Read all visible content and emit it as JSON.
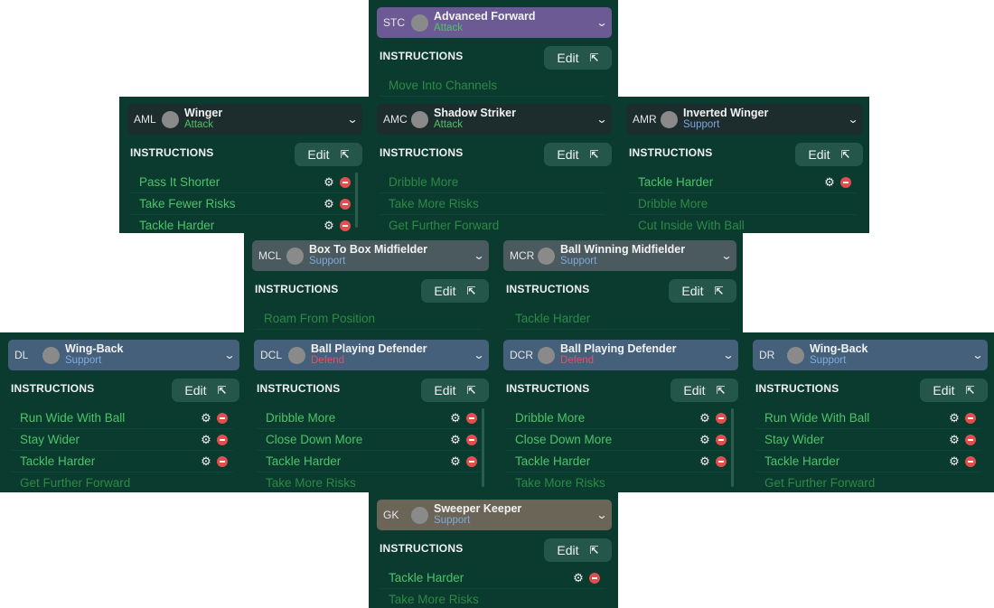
{
  "common": {
    "instructions_label": "INSTRUCTIONS",
    "edit_label": "Edit"
  },
  "panels": {
    "stc": {
      "position": "STC",
      "role": "Advanced Forward",
      "duty": "Attack",
      "instructions": [
        {
          "label": "Move Into Channels",
          "active": false
        }
      ]
    },
    "aml": {
      "position": "AML",
      "role": "Winger",
      "duty": "Attack",
      "instructions": [
        {
          "label": "Pass It Shorter",
          "active": true
        },
        {
          "label": "Take Fewer Risks",
          "active": true
        },
        {
          "label": "Tackle Harder",
          "active": true
        }
      ]
    },
    "amc": {
      "position": "AMC",
      "role": "Shadow Striker",
      "duty": "Attack",
      "instructions": [
        {
          "label": "Dribble More",
          "active": false
        },
        {
          "label": "Take More Risks",
          "active": false
        },
        {
          "label": "Get Further Forward",
          "active": false
        }
      ]
    },
    "amr": {
      "position": "AMR",
      "role": "Inverted Winger",
      "duty": "Support",
      "instructions": [
        {
          "label": "Tackle Harder",
          "active": true
        },
        {
          "label": "Dribble More",
          "active": false
        },
        {
          "label": "Cut Inside With Ball",
          "active": false
        }
      ]
    },
    "mcl": {
      "position": "MCL",
      "role": "Box To Box Midfielder",
      "duty": "Support",
      "instructions": [
        {
          "label": "Roam From Position",
          "active": false
        }
      ]
    },
    "mcr": {
      "position": "MCR",
      "role": "Ball Winning Midfielder",
      "duty": "Support",
      "instructions": [
        {
          "label": "Tackle Harder",
          "active": false
        }
      ]
    },
    "dl": {
      "position": "DL",
      "role": "Wing-Back",
      "duty": "Support",
      "instructions": [
        {
          "label": "Run Wide With Ball",
          "active": true
        },
        {
          "label": "Stay Wider",
          "active": true
        },
        {
          "label": "Tackle Harder",
          "active": true
        },
        {
          "label": "Get Further Forward",
          "active": false
        }
      ]
    },
    "dcl": {
      "position": "DCL",
      "role": "Ball Playing Defender",
      "duty": "Defend",
      "instructions": [
        {
          "label": "Dribble More",
          "active": true
        },
        {
          "label": "Close Down More",
          "active": true
        },
        {
          "label": "Tackle Harder",
          "active": true
        },
        {
          "label": "Take More Risks",
          "active": false
        }
      ]
    },
    "dcr": {
      "position": "DCR",
      "role": "Ball Playing Defender",
      "duty": "Defend",
      "instructions": [
        {
          "label": "Dribble More",
          "active": true
        },
        {
          "label": "Close Down More",
          "active": true
        },
        {
          "label": "Tackle Harder",
          "active": true
        },
        {
          "label": "Take More Risks",
          "active": false
        }
      ]
    },
    "dr": {
      "position": "DR",
      "role": "Wing-Back",
      "duty": "Support",
      "instructions": [
        {
          "label": "Run Wide With Ball",
          "active": true
        },
        {
          "label": "Stay Wider",
          "active": true
        },
        {
          "label": "Tackle Harder",
          "active": true
        },
        {
          "label": "Get Further Forward",
          "active": false
        }
      ]
    },
    "gk": {
      "position": "GK",
      "role": "Sweeper Keeper",
      "duty": "Support",
      "instructions": [
        {
          "label": "Tackle Harder",
          "active": true
        },
        {
          "label": "Take More Risks",
          "active": false
        }
      ]
    }
  },
  "colors": {
    "panel_bg": "#0b3a2e",
    "attack": "#4cc46a",
    "support": "#7ea8e0",
    "defend": "#e0506a",
    "remove": "#e04e4e",
    "edit_bg": "#24574a"
  }
}
